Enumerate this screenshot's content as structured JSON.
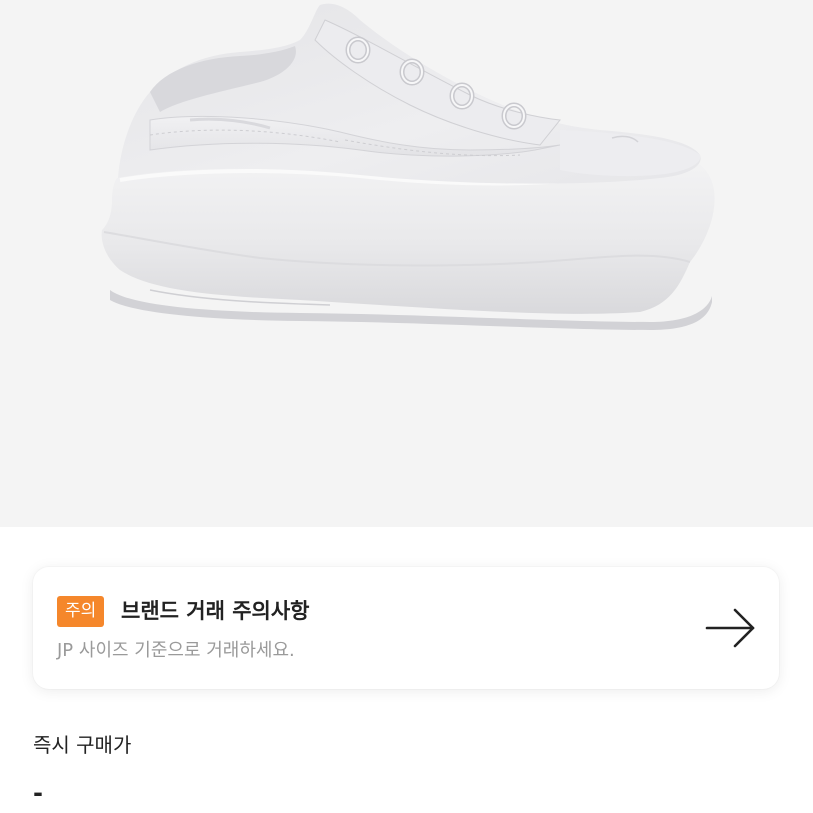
{
  "product": {
    "image_alt": "white platform sneaker",
    "background_color": "#f4f4f4"
  },
  "notice": {
    "badge": "주의",
    "badge_color": "#f5872b",
    "title": "브랜드 거래 주의사항",
    "subtitle": "JP 사이즈 기준으로 거래하세요.",
    "arrow_icon": "arrow-right-icon"
  },
  "price": {
    "label": "즉시 구매가",
    "value": "-"
  }
}
